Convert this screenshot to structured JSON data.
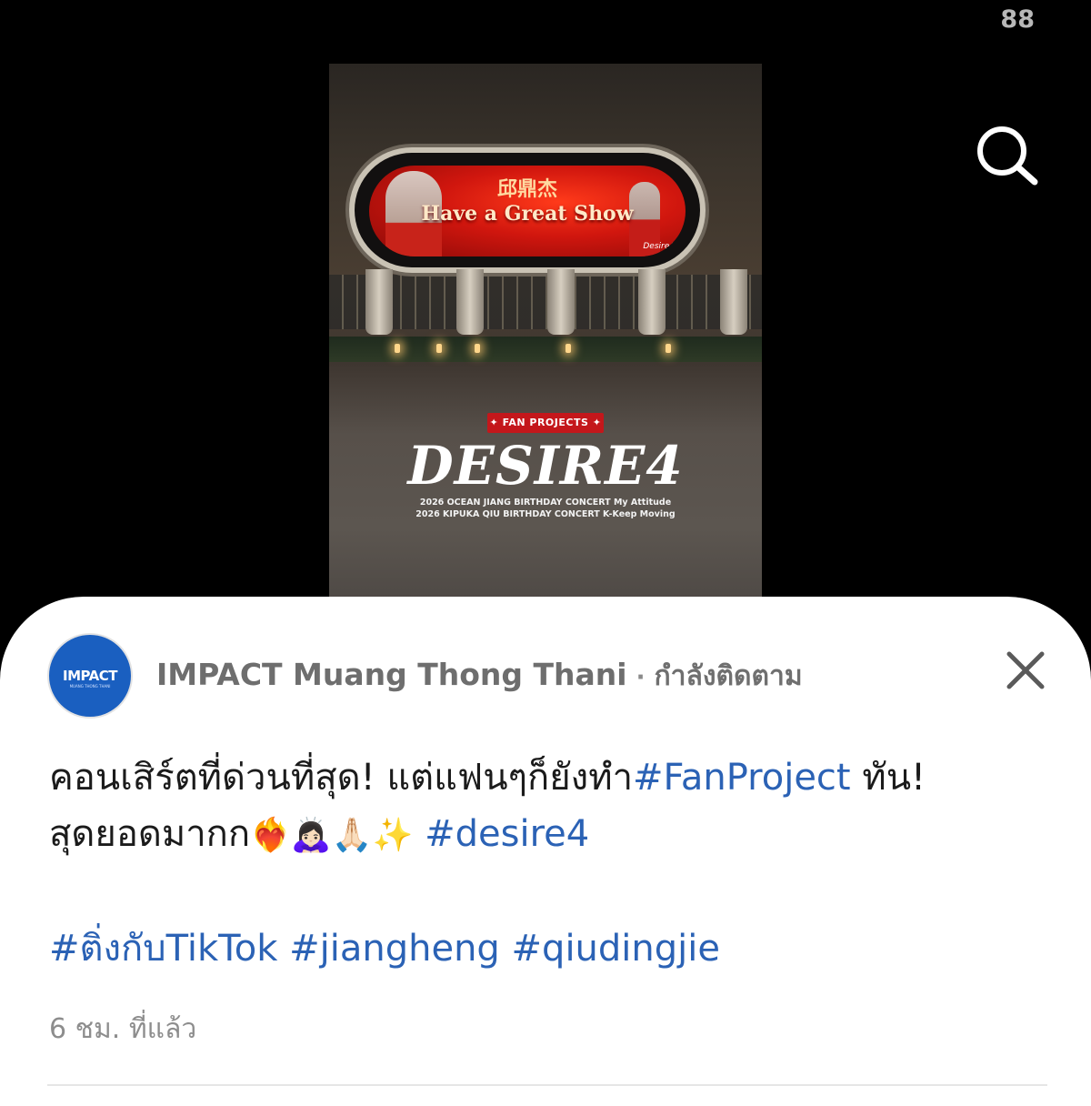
{
  "top_counter": "88",
  "icons": {
    "search": "search-icon",
    "close": "close-icon"
  },
  "video": {
    "billboard_cn": "邱鼎杰",
    "billboard_title": "Have a Great Show",
    "billboard_brand": "Desire4",
    "badge": "✦ FAN PROJECTS ✦",
    "title": "DESIRE4",
    "concert_line_1": "2026 OCEAN JIANG BIRTHDAY CONCERT My Attitude",
    "concert_line_2": "2026 KIPUKA QIU BIRTHDAY CONCERT K-Keep Moving"
  },
  "post": {
    "avatar_text": "IMPACT",
    "avatar_sub": "MUANG THONG THANI",
    "account_name": "IMPACT Muang Thong Thani",
    "separator": "·",
    "follow_status": "กำลังติดตาม",
    "line1_text": "คอนเสิร์ตที่ด่วนที่สุด! แต่แฟนๆก็ยังทำ",
    "line1_tag": "#FanProject",
    "line1_after": " ทัน!",
    "line2_text": "สุดยอดมากก",
    "line2_emojis": "❤️‍🔥🙇🏻‍♀️🙏🏻✨",
    "line2_tag": "#desire4",
    "tag_tiktok": "#ติ่งกับTikTok",
    "tag_jiangheng": "#jiangheng",
    "tag_qiudingjie": "#qiudingjie",
    "timestamp": "6 ชม. ที่แล้ว"
  },
  "colors": {
    "link": "#2b62b5",
    "avatar_bg": "#1a5fc0",
    "badge_red": "#c4171b"
  }
}
